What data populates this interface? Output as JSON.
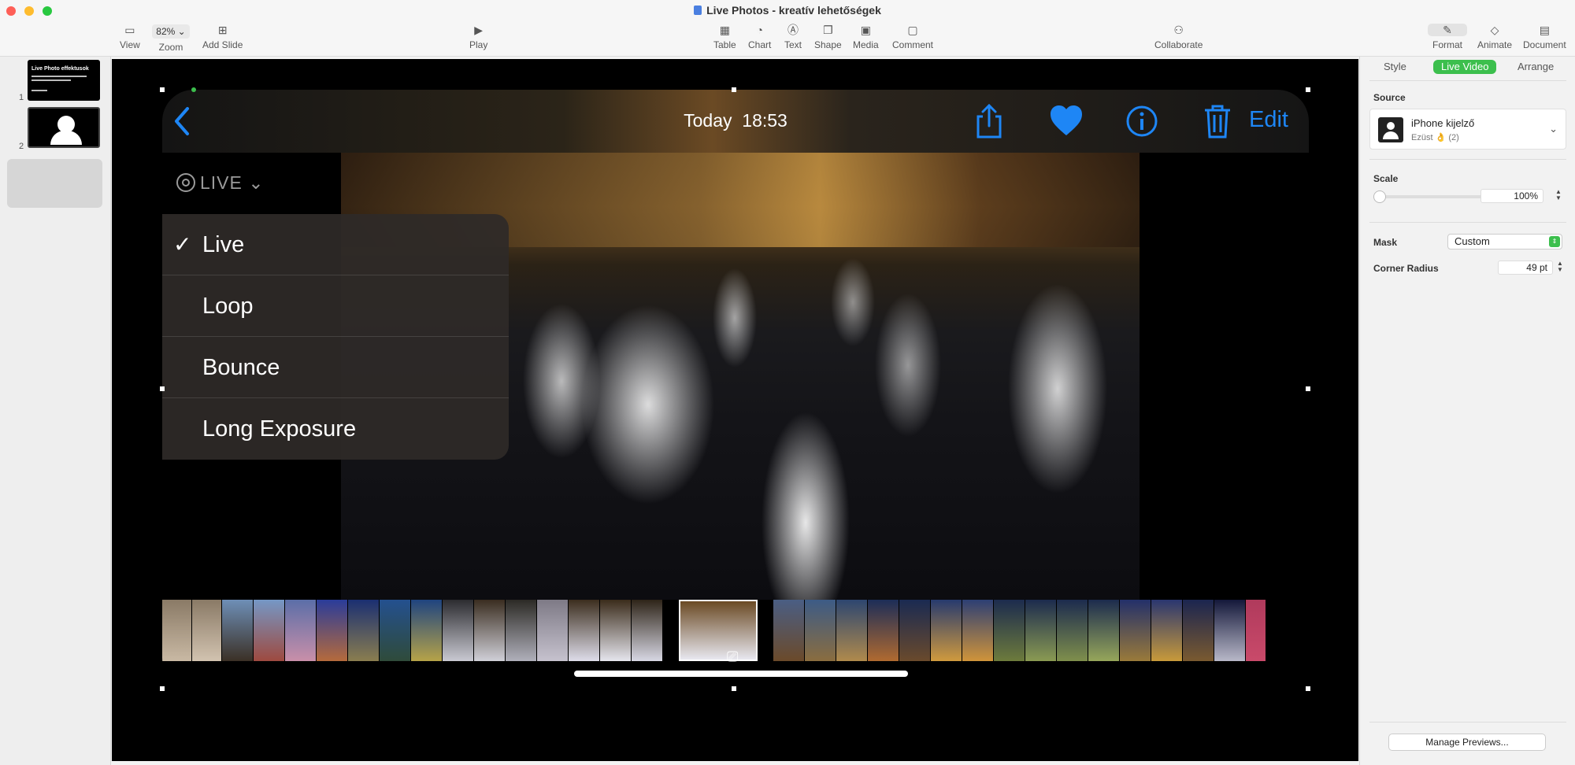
{
  "window": {
    "title": "Live Photos - kreatív lehetőségek"
  },
  "toolbar": {
    "view": "View",
    "zoom_value": "82%",
    "zoom": "Zoom",
    "add_slide": "Add Slide",
    "play": "Play",
    "table": "Table",
    "chart": "Chart",
    "text": "Text",
    "shape": "Shape",
    "media": "Media",
    "comment": "Comment",
    "collaborate": "Collaborate",
    "format": "Format",
    "animate": "Animate",
    "document": "Document"
  },
  "navigator": {
    "slides": [
      {
        "number": "1",
        "title": "Live Photo effektusok"
      },
      {
        "number": "2"
      }
    ]
  },
  "photo_view": {
    "date": "Today",
    "time": "18:53",
    "edit": "Edit",
    "live_badge": "LIVE",
    "menu": [
      {
        "label": "Live",
        "checked": true
      },
      {
        "label": "Loop",
        "checked": false
      },
      {
        "label": "Bounce",
        "checked": false
      },
      {
        "label": "Long Exposure",
        "checked": false
      }
    ]
  },
  "inspector": {
    "tabs": [
      "Style",
      "Live Video",
      "Arrange"
    ],
    "active_tab": "Live Video",
    "source_label": "Source",
    "source_name": "iPhone kijelző",
    "source_sub": "Ezüst 👌 (2)",
    "scale_label": "Scale",
    "scale_value": "100%",
    "mask_label": "Mask",
    "mask_value": "Custom",
    "corner_label": "Corner Radius",
    "corner_value": "49 pt",
    "manage_button": "Manage Previews..."
  },
  "colors": {
    "accent_green": "#3cbf4d",
    "ios_blue": "#1e86f5"
  }
}
